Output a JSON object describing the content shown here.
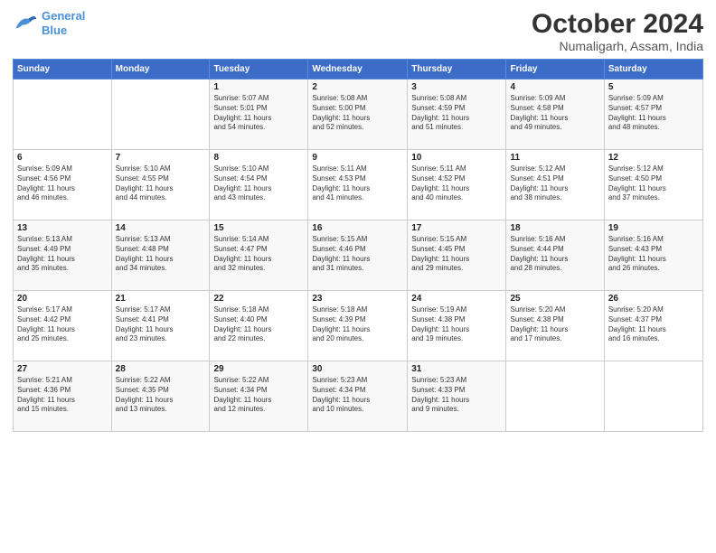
{
  "logo": {
    "line1": "General",
    "line2": "Blue"
  },
  "title": "October 2024",
  "subtitle": "Numaligarh, Assam, India",
  "days_header": [
    "Sunday",
    "Monday",
    "Tuesday",
    "Wednesday",
    "Thursday",
    "Friday",
    "Saturday"
  ],
  "weeks": [
    [
      {
        "num": "",
        "info": ""
      },
      {
        "num": "",
        "info": ""
      },
      {
        "num": "1",
        "info": "Sunrise: 5:07 AM\nSunset: 5:01 PM\nDaylight: 11 hours\nand 54 minutes."
      },
      {
        "num": "2",
        "info": "Sunrise: 5:08 AM\nSunset: 5:00 PM\nDaylight: 11 hours\nand 52 minutes."
      },
      {
        "num": "3",
        "info": "Sunrise: 5:08 AM\nSunset: 4:59 PM\nDaylight: 11 hours\nand 51 minutes."
      },
      {
        "num": "4",
        "info": "Sunrise: 5:09 AM\nSunset: 4:58 PM\nDaylight: 11 hours\nand 49 minutes."
      },
      {
        "num": "5",
        "info": "Sunrise: 5:09 AM\nSunset: 4:57 PM\nDaylight: 11 hours\nand 48 minutes."
      }
    ],
    [
      {
        "num": "6",
        "info": "Sunrise: 5:09 AM\nSunset: 4:56 PM\nDaylight: 11 hours\nand 46 minutes."
      },
      {
        "num": "7",
        "info": "Sunrise: 5:10 AM\nSunset: 4:55 PM\nDaylight: 11 hours\nand 44 minutes."
      },
      {
        "num": "8",
        "info": "Sunrise: 5:10 AM\nSunset: 4:54 PM\nDaylight: 11 hours\nand 43 minutes."
      },
      {
        "num": "9",
        "info": "Sunrise: 5:11 AM\nSunset: 4:53 PM\nDaylight: 11 hours\nand 41 minutes."
      },
      {
        "num": "10",
        "info": "Sunrise: 5:11 AM\nSunset: 4:52 PM\nDaylight: 11 hours\nand 40 minutes."
      },
      {
        "num": "11",
        "info": "Sunrise: 5:12 AM\nSunset: 4:51 PM\nDaylight: 11 hours\nand 38 minutes."
      },
      {
        "num": "12",
        "info": "Sunrise: 5:12 AM\nSunset: 4:50 PM\nDaylight: 11 hours\nand 37 minutes."
      }
    ],
    [
      {
        "num": "13",
        "info": "Sunrise: 5:13 AM\nSunset: 4:49 PM\nDaylight: 11 hours\nand 35 minutes."
      },
      {
        "num": "14",
        "info": "Sunrise: 5:13 AM\nSunset: 4:48 PM\nDaylight: 11 hours\nand 34 minutes."
      },
      {
        "num": "15",
        "info": "Sunrise: 5:14 AM\nSunset: 4:47 PM\nDaylight: 11 hours\nand 32 minutes."
      },
      {
        "num": "16",
        "info": "Sunrise: 5:15 AM\nSunset: 4:46 PM\nDaylight: 11 hours\nand 31 minutes."
      },
      {
        "num": "17",
        "info": "Sunrise: 5:15 AM\nSunset: 4:45 PM\nDaylight: 11 hours\nand 29 minutes."
      },
      {
        "num": "18",
        "info": "Sunrise: 5:16 AM\nSunset: 4:44 PM\nDaylight: 11 hours\nand 28 minutes."
      },
      {
        "num": "19",
        "info": "Sunrise: 5:16 AM\nSunset: 4:43 PM\nDaylight: 11 hours\nand 26 minutes."
      }
    ],
    [
      {
        "num": "20",
        "info": "Sunrise: 5:17 AM\nSunset: 4:42 PM\nDaylight: 11 hours\nand 25 minutes."
      },
      {
        "num": "21",
        "info": "Sunrise: 5:17 AM\nSunset: 4:41 PM\nDaylight: 11 hours\nand 23 minutes."
      },
      {
        "num": "22",
        "info": "Sunrise: 5:18 AM\nSunset: 4:40 PM\nDaylight: 11 hours\nand 22 minutes."
      },
      {
        "num": "23",
        "info": "Sunrise: 5:18 AM\nSunset: 4:39 PM\nDaylight: 11 hours\nand 20 minutes."
      },
      {
        "num": "24",
        "info": "Sunrise: 5:19 AM\nSunset: 4:38 PM\nDaylight: 11 hours\nand 19 minutes."
      },
      {
        "num": "25",
        "info": "Sunrise: 5:20 AM\nSunset: 4:38 PM\nDaylight: 11 hours\nand 17 minutes."
      },
      {
        "num": "26",
        "info": "Sunrise: 5:20 AM\nSunset: 4:37 PM\nDaylight: 11 hours\nand 16 minutes."
      }
    ],
    [
      {
        "num": "27",
        "info": "Sunrise: 5:21 AM\nSunset: 4:36 PM\nDaylight: 11 hours\nand 15 minutes."
      },
      {
        "num": "28",
        "info": "Sunrise: 5:22 AM\nSunset: 4:35 PM\nDaylight: 11 hours\nand 13 minutes."
      },
      {
        "num": "29",
        "info": "Sunrise: 5:22 AM\nSunset: 4:34 PM\nDaylight: 11 hours\nand 12 minutes."
      },
      {
        "num": "30",
        "info": "Sunrise: 5:23 AM\nSunset: 4:34 PM\nDaylight: 11 hours\nand 10 minutes."
      },
      {
        "num": "31",
        "info": "Sunrise: 5:23 AM\nSunset: 4:33 PM\nDaylight: 11 hours\nand 9 minutes."
      },
      {
        "num": "",
        "info": ""
      },
      {
        "num": "",
        "info": ""
      }
    ]
  ]
}
